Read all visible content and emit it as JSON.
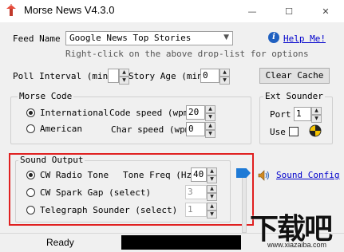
{
  "window": {
    "title": "Morse News V4.3.0",
    "minimize": "—",
    "maximize": "☐",
    "close": "✕"
  },
  "feed": {
    "label": "Feed Name",
    "selected": "Google News Top Stories",
    "hint": "Right-click on the above drop-list for options",
    "help_label": "Help Me!"
  },
  "poll": {
    "label": "Poll Interval (min)",
    "value": "",
    "story_age_label": "Story Age (min)",
    "story_age_value": "0"
  },
  "clear_cache_label": "Clear Cache",
  "morse_code": {
    "title": "Morse Code",
    "options": [
      "International",
      "American"
    ],
    "selected": 0,
    "code_speed_label": "Code speed (wpm)",
    "code_speed_value": "20",
    "char_speed_label": "Char speed (wpm)",
    "char_speed_value": "0"
  },
  "ext_sounder": {
    "title": "Ext Sounder",
    "port_label": "Port",
    "port_value": "1",
    "use_label": "Use"
  },
  "sound_output": {
    "title": "Sound Output",
    "options": [
      "CW Radio Tone",
      "CW Spark Gap (select)",
      "Telegraph Sounder (select)"
    ],
    "selected": 0,
    "tone_freq_label": "Tone Freq (Hz)",
    "tone_freq_value": "40",
    "spark_value": "3",
    "sounder_value": "1"
  },
  "sound_config_label": "Sound Config",
  "status": {
    "text": "Ready"
  },
  "watermark": {
    "text": "下载吧",
    "url": "www.xiazaiba.com"
  },
  "colors": {
    "highlight": "#e02020",
    "link": "#0000cc",
    "volume_slider": "#1e7ad6"
  }
}
